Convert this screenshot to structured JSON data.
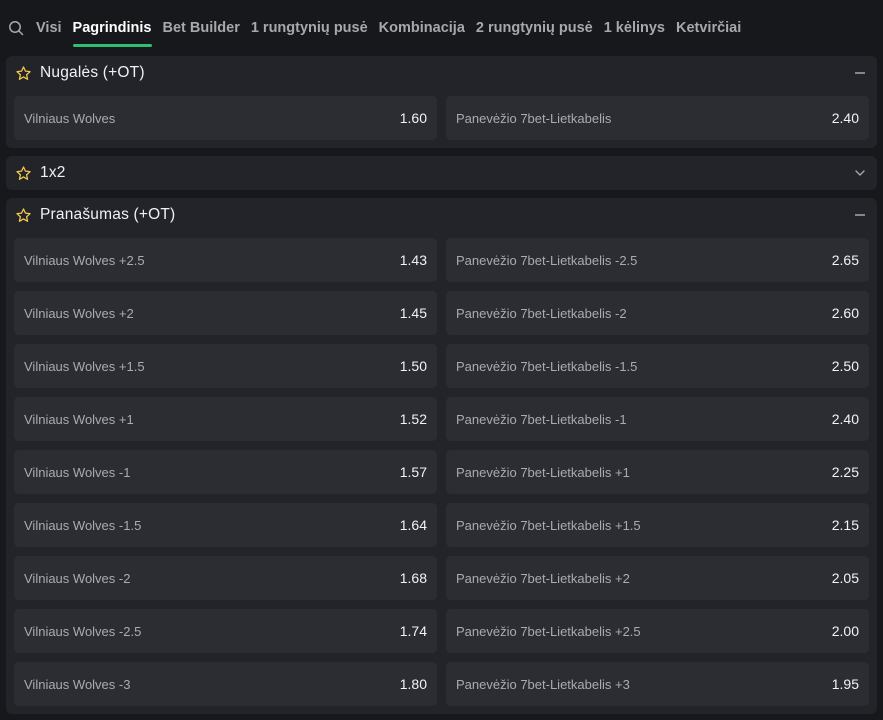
{
  "tabs": [
    {
      "label": "Visi",
      "active": false
    },
    {
      "label": "Pagrindinis",
      "active": true
    },
    {
      "label": "Bet Builder",
      "active": false
    },
    {
      "label": "1 rungtynių pusė",
      "active": false
    },
    {
      "label": "Kombinacija",
      "active": false
    },
    {
      "label": "2 rungtynių pusė",
      "active": false
    },
    {
      "label": "1 kėlinys",
      "active": false
    },
    {
      "label": "Ketvirčiai",
      "active": false
    }
  ],
  "colors": {
    "accent": "#2fbf71",
    "star": "#f2c94c"
  },
  "markets": [
    {
      "title": "Nugalės (+OT)",
      "expanded": true,
      "outcomes": [
        {
          "name": "Vilniaus Wolves",
          "odds": "1.60"
        },
        {
          "name": "Panevėžio 7bet-Lietkabelis",
          "odds": "2.40"
        }
      ]
    },
    {
      "title": "1x2",
      "expanded": false,
      "outcomes": []
    },
    {
      "title": "Pranašumas (+OT)",
      "expanded": true,
      "outcomes": [
        {
          "name": "Vilniaus Wolves +2.5",
          "odds": "1.43"
        },
        {
          "name": "Panevėžio 7bet-Lietkabelis -2.5",
          "odds": "2.65"
        },
        {
          "name": "Vilniaus Wolves +2",
          "odds": "1.45"
        },
        {
          "name": "Panevėžio 7bet-Lietkabelis -2",
          "odds": "2.60"
        },
        {
          "name": "Vilniaus Wolves +1.5",
          "odds": "1.50"
        },
        {
          "name": "Panevėžio 7bet-Lietkabelis -1.5",
          "odds": "2.50"
        },
        {
          "name": "Vilniaus Wolves +1",
          "odds": "1.52"
        },
        {
          "name": "Panevėžio 7bet-Lietkabelis -1",
          "odds": "2.40"
        },
        {
          "name": "Vilniaus Wolves -1",
          "odds": "1.57"
        },
        {
          "name": "Panevėžio 7bet-Lietkabelis +1",
          "odds": "2.25"
        },
        {
          "name": "Vilniaus Wolves -1.5",
          "odds": "1.64"
        },
        {
          "name": "Panevėžio 7bet-Lietkabelis +1.5",
          "odds": "2.15"
        },
        {
          "name": "Vilniaus Wolves -2",
          "odds": "1.68"
        },
        {
          "name": "Panevėžio 7bet-Lietkabelis +2",
          "odds": "2.05"
        },
        {
          "name": "Vilniaus Wolves -2.5",
          "odds": "1.74"
        },
        {
          "name": "Panevėžio 7bet-Lietkabelis +2.5",
          "odds": "2.00"
        },
        {
          "name": "Vilniaus Wolves -3",
          "odds": "1.80"
        },
        {
          "name": "Panevėžio 7bet-Lietkabelis +3",
          "odds": "1.95"
        }
      ]
    }
  ]
}
